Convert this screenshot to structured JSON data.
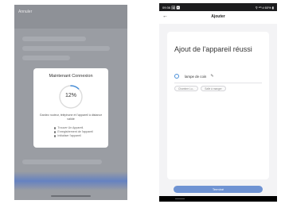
{
  "left_screen": {
    "header_title": "Annuler",
    "modal": {
      "title": "Maintenant Connexion",
      "progress_percent": 12,
      "progress_label": "12%",
      "hint": "Gardez routeur, téléphone et l'appareil à distance valide",
      "steps": [
        "Trouver Un Appareil.",
        "Enregistrement de l'appareil",
        "Initialiser l'appareil"
      ]
    },
    "colors": {
      "ring_track": "#dcdcdc",
      "ring_progress": "#4a90d9",
      "bottom_glow": "#5f7fc4"
    }
  },
  "right_screen": {
    "status_bar": {
      "time": "09:36 🖼 ▶",
      "indicators": "⚲ ⁴ᴳ.ıl 60% ▮"
    },
    "app_bar": {
      "title": "Ajouter",
      "back_icon": "arrow-left-icon"
    },
    "success_title": "Ajout de l'appareil réussi",
    "device": {
      "name": "lampe de coin",
      "icon": "bulb-icon"
    },
    "chips": [
      "Chambre Lu...",
      "Salle à manger"
    ],
    "finish_button": "Terminé",
    "colors": {
      "button": "#6f93d3"
    }
  }
}
